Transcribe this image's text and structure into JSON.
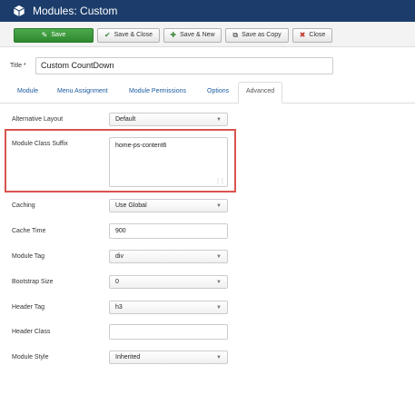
{
  "header": {
    "title": "Modules: Custom",
    "logo_icon": "cube-icon"
  },
  "toolbar": {
    "save": "Save",
    "save_close": "Save & Close",
    "save_new": "Save & New",
    "save_copy": "Save as Copy",
    "close": "Close"
  },
  "form_title": {
    "label": "Title",
    "required_mark": "*",
    "value": "Custom CountDown"
  },
  "tabs": [
    "Module",
    "Menu Assignment",
    "Module Permissions",
    "Options",
    "Advanced"
  ],
  "active_tab": "Advanced",
  "fields": {
    "alternative_layout": {
      "label": "Alternative Layout",
      "value": "Default"
    },
    "module_class_suffix": {
      "label": "Module Class Suffix",
      "value": "home-ps-content6"
    },
    "caching": {
      "label": "Caching",
      "value": "Use Global"
    },
    "cache_time": {
      "label": "Cache Time",
      "value": "900"
    },
    "module_tag": {
      "label": "Module Tag",
      "value": "div"
    },
    "bootstrap_size": {
      "label": "Bootstrap Size",
      "value": "0"
    },
    "header_tag": {
      "label": "Header Tag",
      "value": "h3"
    },
    "header_class": {
      "label": "Header Class",
      "value": ""
    },
    "module_style": {
      "label": "Module Style",
      "value": "Inherited"
    }
  },
  "colors": {
    "header_bg": "#1c3d6b",
    "save_green": "#3c9a3c",
    "highlight_red": "#d9534f",
    "link_blue": "#1a5aa0"
  }
}
